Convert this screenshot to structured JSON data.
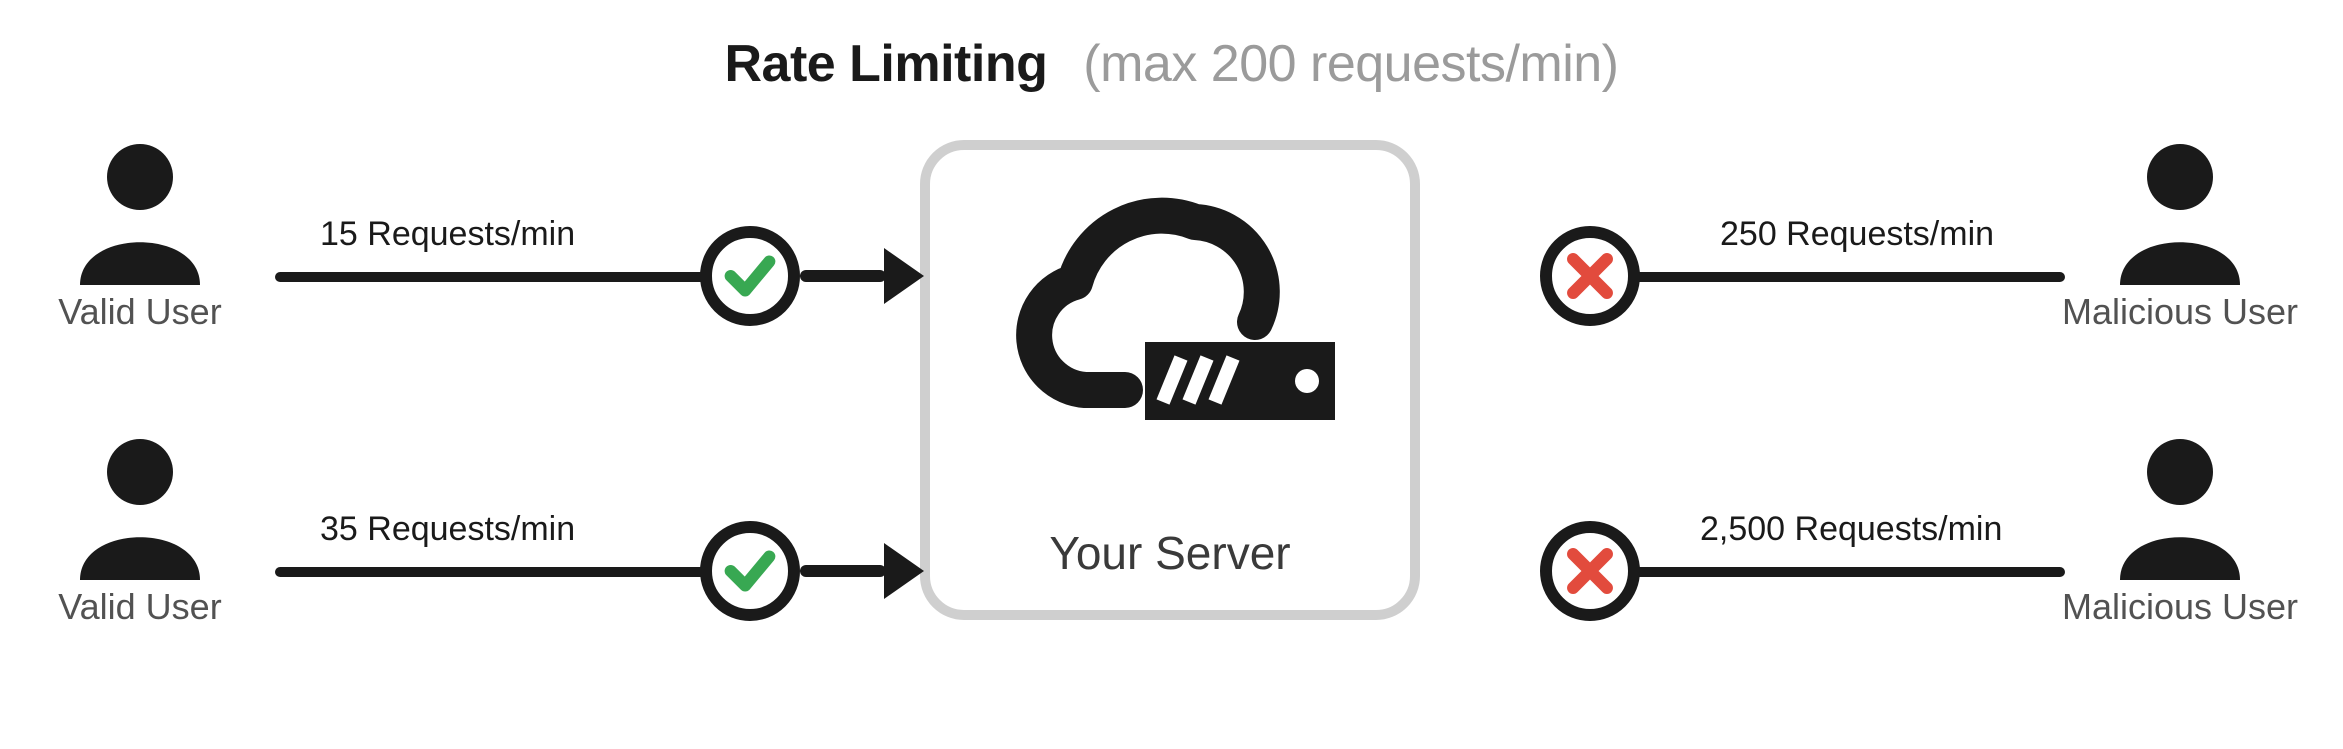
{
  "title": {
    "main": "Rate Limiting",
    "sub": "(max 200 requests/min)"
  },
  "server": {
    "label": "Your Server"
  },
  "left_users": [
    {
      "label": "Valid User",
      "rate": "15 Requests/min",
      "status": "allow"
    },
    {
      "label": "Valid User",
      "rate": "35 Requests/min",
      "status": "allow"
    }
  ],
  "right_users": [
    {
      "label": "Malicious User",
      "rate": "250 Requests/min",
      "status": "block"
    },
    {
      "label": "Malicious User",
      "rate": "2,500 Requests/min",
      "status": "block"
    }
  ],
  "colors": {
    "check": "#38a852",
    "cross": "#e24b3d",
    "line": "#1a1a1a",
    "muted": "#9b9b9b",
    "box": "#cfcfcf"
  }
}
